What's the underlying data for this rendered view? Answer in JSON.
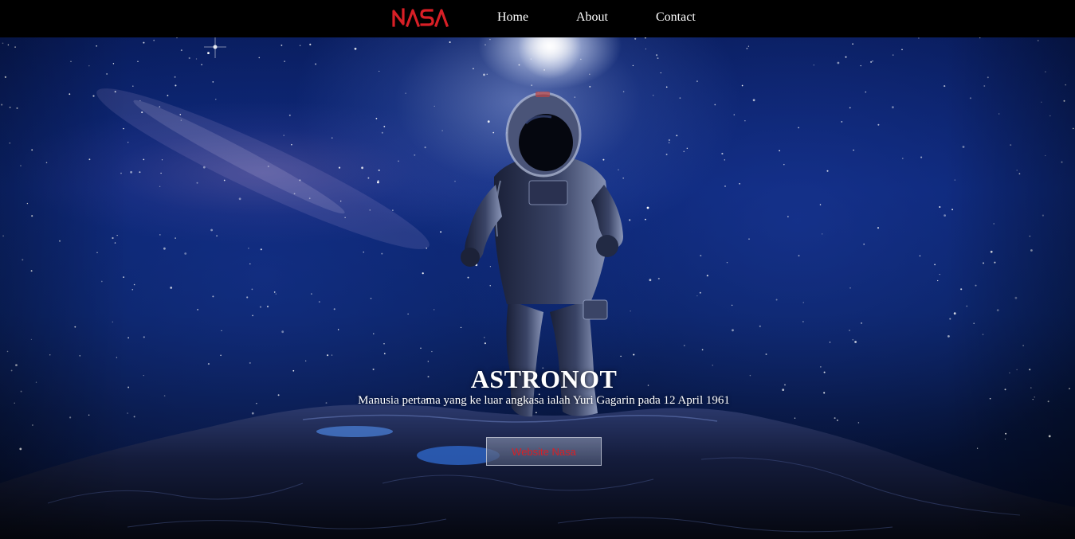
{
  "brand": {
    "logo_text": "NASA",
    "logo_color": "#d81f26"
  },
  "nav": {
    "items": [
      {
        "label": "Home"
      },
      {
        "label": "About"
      },
      {
        "label": "Contact"
      }
    ]
  },
  "hero": {
    "title": "ASTRONOT",
    "subtitle": "Manusia pertama yang ke luar angkasa ialah Yuri Gagarin pada 12 April 1961",
    "button_label": "Website Nasa",
    "button_text_color": "#d81f26"
  },
  "colors": {
    "navbar_bg": "#000000",
    "nav_text": "#ffffff",
    "space_blue": "#0a2472"
  }
}
